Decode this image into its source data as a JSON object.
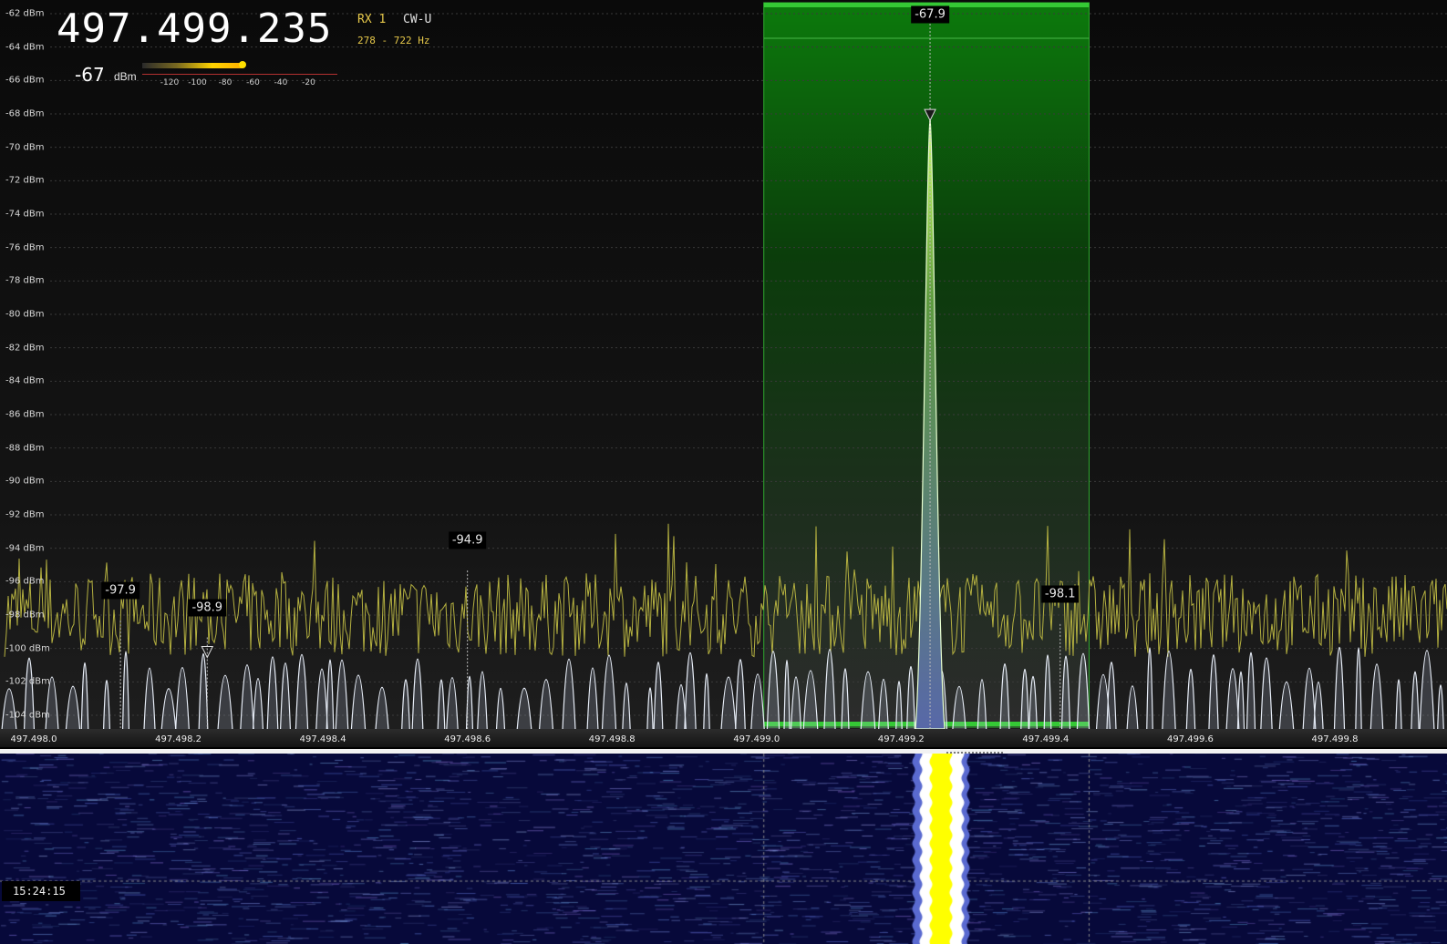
{
  "receiver": {
    "frequency": "497.499.235",
    "rx": "RX 1",
    "mode": "CW-U",
    "bandwidth": "278 - 722 Hz"
  },
  "smeter": {
    "value": "-67",
    "unit": "dBm",
    "scale": [
      "-120",
      "-100",
      "-80",
      "-60",
      "-40",
      "-20"
    ],
    "level_dbm": -67
  },
  "dbm_axis": [
    "-62 dBm",
    "-64 dBm",
    "-66 dBm",
    "-68 dBm",
    "-70 dBm",
    "-72 dBm",
    "-74 dBm",
    "-76 dBm",
    "-78 dBm",
    "-80 dBm",
    "-82 dBm",
    "-84 dBm",
    "-86 dBm",
    "-88 dBm",
    "-90 dBm",
    "-92 dBm",
    "-94 dBm",
    "-96 dBm",
    "-98 dBm",
    "-100 dBm",
    "-102 dBm",
    "-104 dBm"
  ],
  "freq_axis": [
    "497.498.0",
    "497.498.2",
    "497.498.4",
    "497.498.6",
    "497.498.8",
    "497.499.0",
    "497.499.2",
    "497.499.4",
    "497.499.6",
    "497.499.8"
  ],
  "peaks": [
    {
      "label": "-67.9",
      "freq": 497.49924,
      "dbm": -67.9
    },
    {
      "label": "-98.9",
      "freq": 497.49824,
      "dbm": -98.9
    },
    {
      "label": "-97.9",
      "freq": 497.49812,
      "dbm": -97.9
    },
    {
      "label": "-94.9",
      "freq": 497.4986,
      "dbm": -94.9
    },
    {
      "label": "-98.1",
      "freq": 497.49942,
      "dbm": -98.1
    }
  ],
  "passband": {
    "start": 497.49901,
    "end": 497.49946
  },
  "waterfall": {
    "timestamp": "15:24:15"
  },
  "colors": {
    "passband": "#2faa2f",
    "noise_trace": "#b4b040",
    "signal_trace": "#e8eef8",
    "waterfall_bg": "#07093a",
    "waterfall_signal": "#ffff00"
  }
}
